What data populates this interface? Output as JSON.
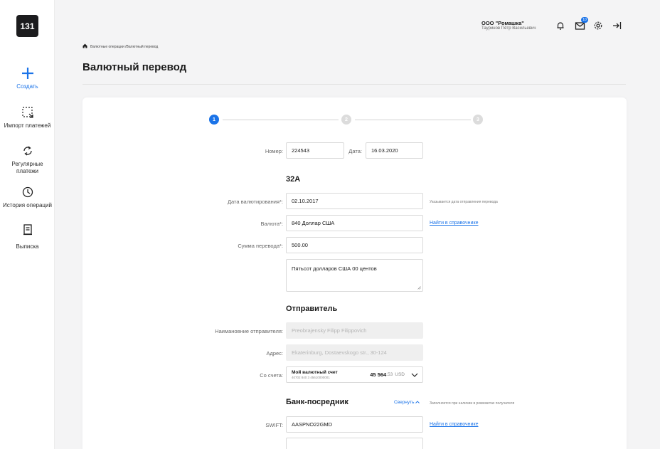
{
  "app": {
    "logo": "131",
    "company": "ООО \"Ромашка\"",
    "user": "Тауринов Пётр Васильевич",
    "mail_count": "10"
  },
  "sidebar": {
    "items": [
      {
        "label": "Создать",
        "icon": "plus-icon"
      },
      {
        "label": "Импорт платежей",
        "icon": "import-icon"
      },
      {
        "label": "Регулярные платежи",
        "icon": "repeat-icon"
      },
      {
        "label": "История операций",
        "icon": "clock-icon"
      },
      {
        "label": "Выписка",
        "icon": "document-icon"
      }
    ]
  },
  "breadcrumb": {
    "text": "Валютные операции /Валютный перевод"
  },
  "page": {
    "title": "Валютный перевод"
  },
  "steps": [
    "1",
    "2",
    "3"
  ],
  "form": {
    "number_label": "Номер:",
    "number_value": "224543",
    "date_label": "Дата:",
    "date_value": "16.03.2020",
    "section_32a": "32A",
    "value_date_label": "Дата валютирования*:",
    "value_date": "02.10.2017",
    "value_date_hint": "Указывается дата отправления перевода",
    "currency_label": "Валюта*:",
    "currency": "840 Доллар США",
    "lookup_link": "Найти в справочнике",
    "amount_label": "Сумма перевода*:",
    "amount": "500.00",
    "amount_words": "Пятьсот долларов США 00 центов",
    "section_sender": "Отправитель",
    "sender_name_label": "Наимановние отправителя:",
    "sender_name": "Preobrajensky Filipp Filippovich",
    "address_label": "Адрес:",
    "address": "Ekaterinburg, Dostaevskogo str., 30-124",
    "account_label": "Со счета:",
    "account_name": "Мой валютный счет",
    "account_number": "40702 840 3 45610000001",
    "balance_main": "45 564",
    "balance_cents": ".53",
    "balance_currency": "USD",
    "section_bank": "Банк-посредник",
    "collapse": "Свернуть",
    "bank_hint": "Заполняется при наличии в реквизитах получателя",
    "swift_label": "SWIFT:",
    "swift": "AASPNO22GMD",
    "swift_lookup": "Найти в справочнике"
  },
  "colors": {
    "accent": "#1a73e8",
    "sidebar_bg": "#ffffff",
    "page_bg": "#f4f4f5"
  }
}
